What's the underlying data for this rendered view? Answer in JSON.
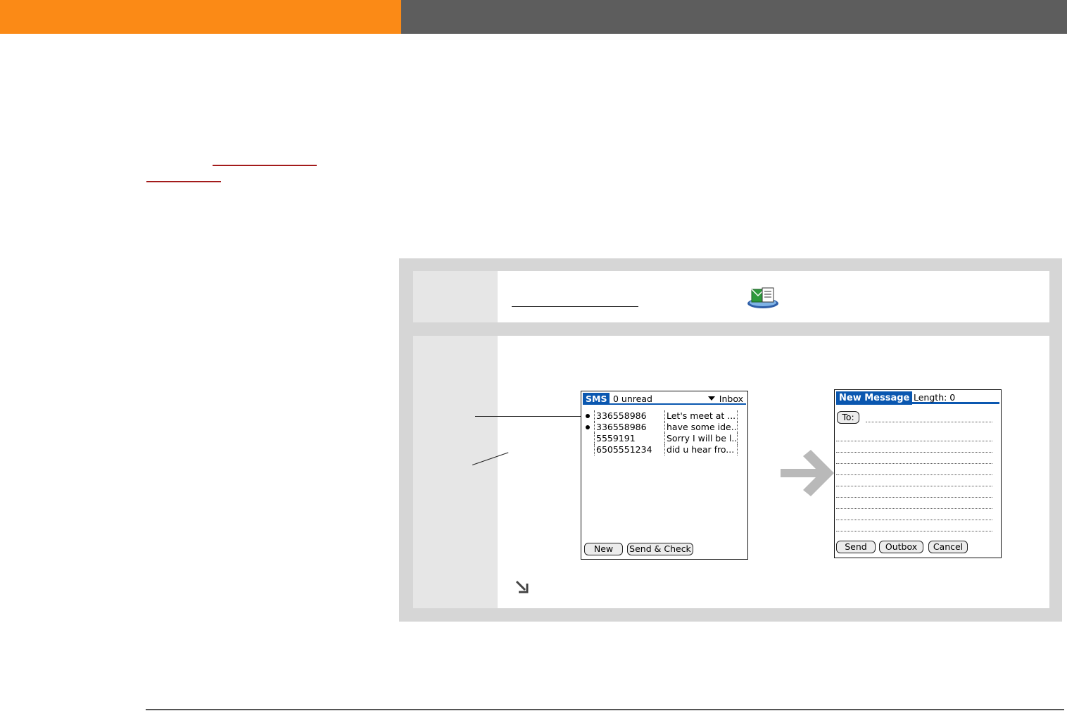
{
  "sms_screen": {
    "title": "SMS",
    "unread": "0 unread",
    "category": "Inbox",
    "messages": [
      {
        "number": "336558986",
        "preview": "Let's meet at ...",
        "unread": true
      },
      {
        "number": "336558986",
        "preview": "have some ide...",
        "unread": true
      },
      {
        "number": "5559191",
        "preview": "Sorry I will be l...",
        "unread": false
      },
      {
        "number": "6505551234",
        "preview": "did u hear fro...",
        "unread": false
      }
    ],
    "buttons": {
      "new": "New",
      "send_check": "Send & Check"
    }
  },
  "new_message_screen": {
    "title": "New Message",
    "length": "Length: 0",
    "to_label": "To:",
    "buttons": {
      "send": "Send",
      "outbox": "Outbox",
      "cancel": "Cancel"
    }
  },
  "icons": {
    "sms_app": "sms-app-icon",
    "next_arrow": "right-arrow-icon",
    "continue": "continued-arrow-icon"
  },
  "colors": {
    "header_orange": "#fb8a16",
    "header_gray": "#5d5d5d",
    "palm_blue": "#0a57b0",
    "link_red": "#a31b1b"
  }
}
